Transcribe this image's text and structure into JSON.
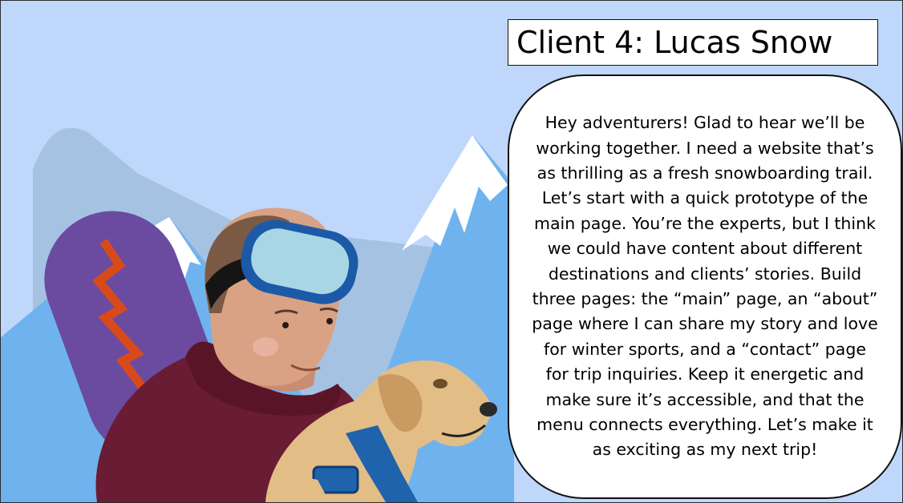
{
  "slide": {
    "title": "Client 4: Lucas Snow",
    "message": "Hey adventurers! Glad to hear we’ll be working together. I need a website that’s as thrilling as a fresh snowboarding trail. Let’s start with a quick prototype of the main page. You’re the experts, but I think we could have content about different destinations and clients’ stories. Build three pages: the “main” page, an “about” page where I can share my story and love for winter sports, and a “contact” page for trip inquiries. Keep it energetic and make sure it’s accessible, and that the menu connects everything. Let’s make it as exciting as my next trip!"
  },
  "colors": {
    "sky": "#bfd7fb",
    "mountain_back": "#9fbde0",
    "mountain_front": "#6cb2ee",
    "snow": "#ffffff",
    "snowboard": "#6a4ba0",
    "lightning": "#d94a1a",
    "goggles_lens": "#a9d6e4",
    "goggles_frame": "#1c5aa7",
    "hair": "#7a5a44",
    "skin": "#d9a284",
    "hoodie": "#6a1c34",
    "dog_fur": "#e3bd86",
    "harness": "#1f63ad"
  }
}
